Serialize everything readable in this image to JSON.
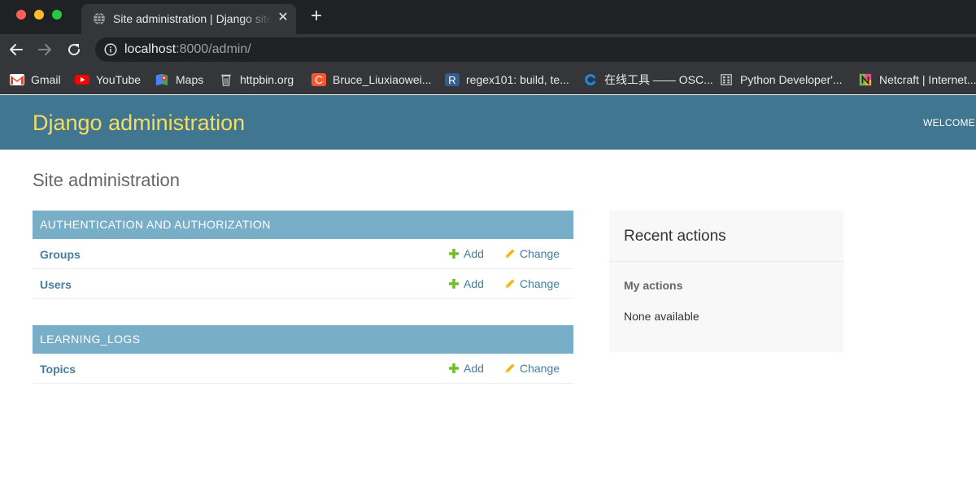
{
  "browser": {
    "tab": {
      "title": "Site administration | Django site admin",
      "favicon": "globe-icon"
    },
    "address_bar": {
      "host": "localhost",
      "rest": ":8000/admin/"
    },
    "bookmarks": [
      {
        "label": "Gmail",
        "icon": "gmail-icon"
      },
      {
        "label": "YouTube",
        "icon": "youtube-icon"
      },
      {
        "label": "Maps",
        "icon": "maps-icon"
      },
      {
        "label": "httpbin.org",
        "icon": "httpbin-icon"
      },
      {
        "label": "Bruce_Liuxiaowei...",
        "icon": "csdn-icon",
        "glyph": "C"
      },
      {
        "label": "regex101: build, te...",
        "icon": "regex101-icon",
        "glyph": "R"
      },
      {
        "label": "在线工具 —— OSC...",
        "icon": "oschina-icon"
      },
      {
        "label": "Python Developer'...",
        "icon": "python-docs-icon"
      },
      {
        "label": "Netcraft | Internet...",
        "icon": "netcraft-icon"
      }
    ]
  },
  "admin": {
    "branding": "Django administration",
    "user_tools": "WELCOME,",
    "page_title": "Site administration",
    "modules": [
      {
        "caption": "AUTHENTICATION AND AUTHORIZATION",
        "rows": [
          {
            "name": "Groups",
            "add": "Add",
            "change": "Change"
          },
          {
            "name": "Users",
            "add": "Add",
            "change": "Change"
          }
        ]
      },
      {
        "caption": "LEARNING_LOGS",
        "rows": [
          {
            "name": "Topics",
            "add": "Add",
            "change": "Change"
          }
        ]
      }
    ],
    "recent_actions": {
      "title": "Recent actions",
      "subtitle": "My actions",
      "empty": "None available"
    }
  },
  "colors": {
    "header_bg": "#417690",
    "branding": "#f5dd5d",
    "module_caption_bg": "#79aec8",
    "link": "#447e9b",
    "add_icon": "#70bf2b",
    "change_icon": "#efb80b"
  }
}
